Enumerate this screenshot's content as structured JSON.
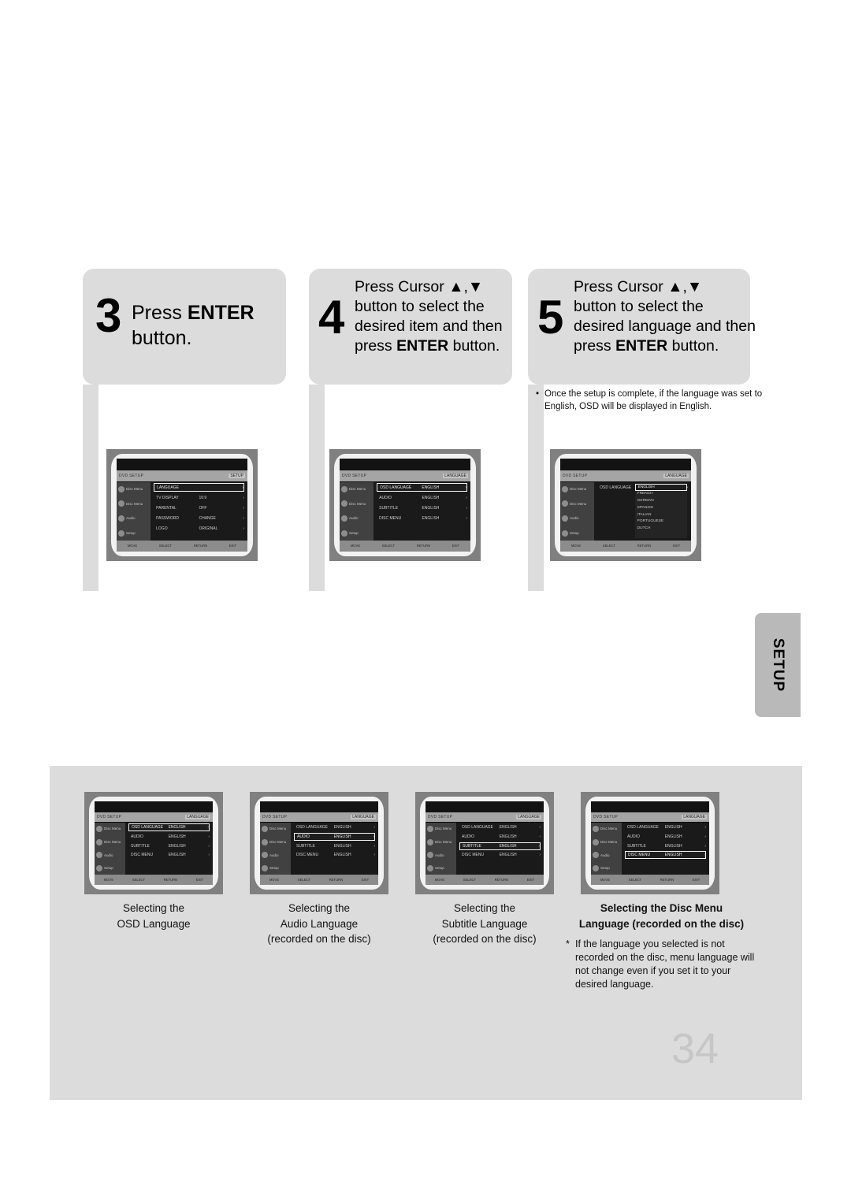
{
  "steps": [
    {
      "number": "3",
      "lines": [
        [
          {
            "t": "Press ",
            "b": false
          },
          {
            "t": "ENTER",
            "b": true
          }
        ],
        [
          {
            "t": "button.",
            "b": false
          }
        ]
      ]
    },
    {
      "number": "4",
      "lines": [
        [
          {
            "t": "Press Cursor  ▲,▼",
            "b": false
          }
        ],
        [
          {
            "t": "button to select the",
            "b": false
          }
        ],
        [
          {
            "t": "desired item and then",
            "b": false
          }
        ],
        [
          {
            "t": "press ",
            "b": false
          },
          {
            "t": "ENTER",
            "b": true
          },
          {
            "t": " button.",
            "b": false
          }
        ]
      ]
    },
    {
      "number": "5",
      "lines": [
        [
          {
            "t": "Press Cursor  ▲,▼",
            "b": false
          }
        ],
        [
          {
            "t": "button to select the",
            "b": false
          }
        ],
        [
          {
            "t": "desired language and then",
            "b": false
          }
        ],
        [
          {
            "t": "press ",
            "b": false
          },
          {
            "t": "ENTER",
            "b": true
          },
          {
            "t": " button.",
            "b": false
          }
        ]
      ]
    }
  ],
  "note_step5": {
    "bullet": "•",
    "text": "Once the setup is complete, if the language was set to English, OSD will be displayed in English."
  },
  "screens": {
    "setup_main": {
      "title_left": "DVD SETUP",
      "title_right": "SETUP",
      "side_items": [
        "Disc Menu",
        "Disc Menu",
        "Audio",
        "Setup"
      ],
      "rows": [
        {
          "key": "LANGUAGE",
          "value": "",
          "selected": true
        },
        {
          "key": "TV DISPLAY",
          "value": "16:9",
          "selected": false
        },
        {
          "key": "PARENTAL",
          "value": "OFF",
          "selected": false
        },
        {
          "key": "PASSWORD",
          "value": "CHANGE",
          "selected": false
        },
        {
          "key": "LOGO",
          "value": "ORIGINAL",
          "selected": false
        }
      ],
      "bottom": [
        "MOVE",
        "SELECT",
        "RETURN",
        "EXIT"
      ]
    },
    "language_list": {
      "title_left": "DVD SETUP",
      "title_right": "LANGUAGE",
      "side_items": [
        "Disc Menu",
        "Disc Menu",
        "Audio",
        "Setup"
      ],
      "rows": [
        {
          "key": "OSD LANGUAGE",
          "value": "ENGLISH",
          "selected": true
        },
        {
          "key": "AUDIO",
          "value": "ENGLISH",
          "selected": false
        },
        {
          "key": "SUBTITLE",
          "value": "ENGLISH",
          "selected": false
        },
        {
          "key": "DISC MENU",
          "value": "ENGLISH",
          "selected": false
        }
      ],
      "bottom": [
        "MOVE",
        "SELECT",
        "RETURN",
        "EXIT"
      ]
    },
    "osd_dropdown": {
      "title_left": "DVD SETUP",
      "title_right": "LANGUAGE",
      "side_items": [
        "Disc Menu",
        "Disc Menu",
        "Audio",
        "Setup"
      ],
      "rows": [
        {
          "key": "OSD LANGUAGE",
          "value": "",
          "selected": false
        }
      ],
      "dropdown": [
        {
          "label": "ENGLISH",
          "selected": true
        },
        {
          "label": "FRENCH",
          "selected": false
        },
        {
          "label": "GERMAN",
          "selected": false
        },
        {
          "label": "SPANISH",
          "selected": false
        },
        {
          "label": "ITALIAN",
          "selected": false
        },
        {
          "label": "PORTUGUESE",
          "selected": false
        },
        {
          "label": "DUTCH",
          "selected": false
        }
      ],
      "bottom": [
        "MOVE",
        "SELECT",
        "RETURN",
        "EXIT"
      ]
    },
    "sel_osd": {
      "title_left": "DVD SETUP",
      "title_right": "LANGUAGE",
      "side_items": [
        "Disc Menu",
        "Disc Menu",
        "Audio",
        "Setup"
      ],
      "rows": [
        {
          "key": "OSD LANGUAGE",
          "value": "ENGLISH",
          "selected": true
        },
        {
          "key": "AUDIO",
          "value": "ENGLISH",
          "selected": false
        },
        {
          "key": "SUBTITLE",
          "value": "ENGLISH",
          "selected": false
        },
        {
          "key": "DISC MENU",
          "value": "ENGLISH",
          "selected": false
        }
      ],
      "bottom": [
        "MOVE",
        "SELECT",
        "RETURN",
        "EXIT"
      ]
    },
    "sel_audio": {
      "title_left": "DVD SETUP",
      "title_right": "LANGUAGE",
      "side_items": [
        "Disc Menu",
        "Disc Menu",
        "Audio",
        "Setup"
      ],
      "rows": [
        {
          "key": "OSD LANGUAGE",
          "value": "ENGLISH",
          "selected": false
        },
        {
          "key": "AUDIO",
          "value": "ENGLISH",
          "selected": true
        },
        {
          "key": "SUBTITLE",
          "value": "ENGLISH",
          "selected": false
        },
        {
          "key": "DISC MENU",
          "value": "ENGLISH",
          "selected": false
        }
      ],
      "bottom": [
        "MOVE",
        "SELECT",
        "RETURN",
        "EXIT"
      ]
    },
    "sel_subtitle": {
      "title_left": "DVD SETUP",
      "title_right": "LANGUAGE",
      "side_items": [
        "Disc Menu",
        "Disc Menu",
        "Audio",
        "Setup"
      ],
      "rows": [
        {
          "key": "OSD LANGUAGE",
          "value": "ENGLISH",
          "selected": false
        },
        {
          "key": "AUDIO",
          "value": "ENGLISH",
          "selected": false
        },
        {
          "key": "SUBTITLE",
          "value": "ENGLISH",
          "selected": true
        },
        {
          "key": "DISC MENU",
          "value": "ENGLISH",
          "selected": false
        }
      ],
      "bottom": [
        "MOVE",
        "SELECT",
        "RETURN",
        "EXIT"
      ]
    },
    "sel_discmenu": {
      "title_left": "DVD SETUP",
      "title_right": "LANGUAGE",
      "side_items": [
        "Disc Menu",
        "Disc Menu",
        "Audio",
        "Setup"
      ],
      "rows": [
        {
          "key": "OSD LANGUAGE",
          "value": "ENGLISH",
          "selected": false
        },
        {
          "key": "AUDIO",
          "value": "ENGLISH",
          "selected": false
        },
        {
          "key": "SUBTITLE",
          "value": "ENGLISH",
          "selected": false
        },
        {
          "key": "DISC MENU",
          "value": "ENGLISH",
          "selected": true
        }
      ],
      "bottom": [
        "MOVE",
        "SELECT",
        "RETURN",
        "EXIT"
      ]
    }
  },
  "side_tab": {
    "label": "SETUP"
  },
  "bottom_panel": {
    "captions": [
      {
        "bold": false,
        "lines": [
          "Selecting the",
          "OSD Language"
        ]
      },
      {
        "bold": false,
        "lines": [
          "Selecting the",
          "Audio Language",
          "(recorded on the disc)"
        ]
      },
      {
        "bold": false,
        "lines": [
          "Selecting the",
          "Subtitle Language",
          "(recorded on the disc)"
        ]
      },
      {
        "bold": true,
        "lines": [
          "Selecting the Disc Menu",
          "Language (recorded on the disc)"
        ]
      }
    ],
    "footnote": {
      "star": "*",
      "text": "If the language you selected is not recorded on the disc, menu language will not change even if you set it to your desired language."
    }
  },
  "page_number": "34"
}
